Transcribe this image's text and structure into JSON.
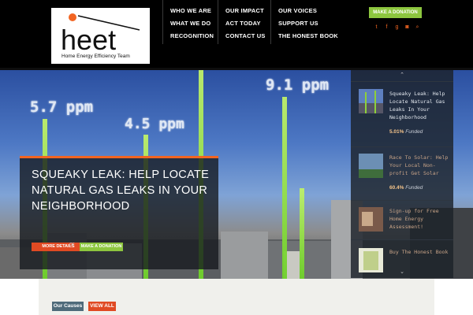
{
  "brand": {
    "wordmark": "heet",
    "tagline": "Home Energy Efficiency Team",
    "accent_color": "#f26522",
    "green_color": "#8dc63f"
  },
  "nav": {
    "col1": [
      "WHO WE ARE",
      "WHAT WE DO",
      "RECOGNITION"
    ],
    "col2": [
      "OUR IMPACT",
      "ACT TODAY",
      "CONTACT US"
    ],
    "col3": [
      "OUR VOICES",
      "SUPPORT US",
      "THE HONEST BOOK"
    ]
  },
  "header": {
    "donate_label": "MAKE A DONATION",
    "social_icons": [
      "twitter-icon",
      "facebook-icon",
      "googleplus-icon",
      "instagram-icon",
      "search-icon"
    ]
  },
  "hero": {
    "ppm_labels": [
      "5.7 ppm",
      "4.5 ppm",
      "9.1 ppm"
    ],
    "title": "SQUEAKY LEAK: HELP LOCATE NATURAL GAS LEAKS IN YOUR NEIGHBORHOOD",
    "more_details_label": "MORE DETAILS",
    "or_label": "or",
    "donate_label": "MAKE A DONATION"
  },
  "sidebar": {
    "items": [
      {
        "title": "Squeaky Leak: Help Locate Natural Gas Leaks In Your Neighborhood",
        "percent": "5.01%",
        "status": "Funded"
      },
      {
        "title": "Race To Solar: Help Your Local Non-profit Get Solar",
        "percent": "60.4%",
        "status": "Funded"
      },
      {
        "title": "Sign-up for Free Home Energy Assessment!",
        "percent": "",
        "status": ""
      },
      {
        "title": "Buy The Honest Book",
        "percent": "",
        "status": ""
      }
    ]
  },
  "causes": {
    "our_causes_label": "Our Causes",
    "view_all_label": "VIEW ALL"
  }
}
